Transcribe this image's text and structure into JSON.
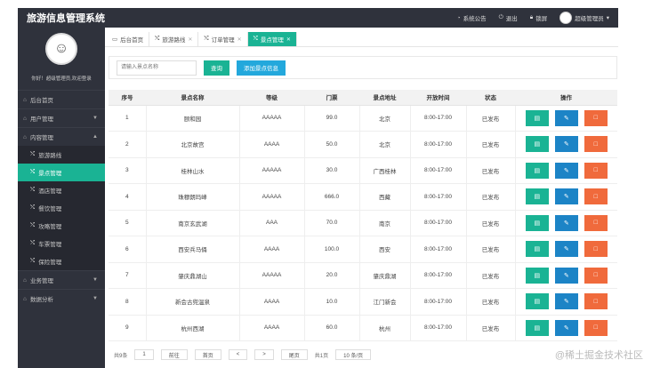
{
  "app": {
    "title": "旅游信息管理系统"
  },
  "topbar": {
    "notice": "系统公告",
    "logout": "退出",
    "lock": "锁屏",
    "user": "超级管理员"
  },
  "profile": {
    "greeting": "你好！超级管理员,欢迎登录"
  },
  "sidebar": {
    "home": "后台首页",
    "user_mgmt": "用户管理",
    "content_mgmt": "内容管理",
    "sub_items": [
      "旅游路线",
      "景点管理",
      "酒店管理",
      "餐饮管理",
      "攻略管理",
      "车票管理",
      "保险管理"
    ],
    "business": "业务管理",
    "analysis": "数据分析"
  },
  "tabs": [
    "后台首页",
    "旅游路线",
    "订单管理",
    "景点管理"
  ],
  "search": {
    "placeholder": "请输入景点名称",
    "query_btn": "查询",
    "add_btn": "添加景点信息"
  },
  "table": {
    "headers": [
      "序号",
      "景点名称",
      "等级",
      "门票",
      "景点地址",
      "开放时间",
      "状态",
      "操作"
    ],
    "rows": [
      [
        "1",
        "颐和园",
        "AAAAA",
        "99.0",
        "北京",
        "8:00-17:00",
        "已发布"
      ],
      [
        "2",
        "北京故宫",
        "AAAA",
        "50.0",
        "北京",
        "8:00-17:00",
        "已发布"
      ],
      [
        "3",
        "桂林山水",
        "AAAAA",
        "30.0",
        "广西桂林",
        "8:00-17:00",
        "已发布"
      ],
      [
        "4",
        "珠穆朗玛峰",
        "AAAAA",
        "666.0",
        "西藏",
        "8:00-17:00",
        "已发布"
      ],
      [
        "5",
        "南京玄武湖",
        "AAA",
        "70.0",
        "南京",
        "8:00-17:00",
        "已发布"
      ],
      [
        "6",
        "西安兵马俑",
        "AAAA",
        "100.0",
        "西安",
        "8:00-17:00",
        "已发布"
      ],
      [
        "7",
        "肇庆鼎湖山",
        "AAAAA",
        "20.0",
        "肇庆鼎湖",
        "8:00-17:00",
        "已发布"
      ],
      [
        "8",
        "新会古兜温泉",
        "AAAA",
        "10.0",
        "江门新会",
        "8:00-17:00",
        "已发布"
      ],
      [
        "9",
        "杭州西湖",
        "AAAA",
        "60.0",
        "杭州",
        "8:00-17:00",
        "已发布"
      ]
    ]
  },
  "pager": {
    "total": "共9条",
    "page": "1",
    "goto": "前往",
    "first": "首页",
    "prev": "<",
    "next": ">",
    "last": "尾页",
    "pages": "共1页",
    "per_page": "10 条/页"
  },
  "watermark": "@稀土掘金技术社区",
  "colors": {
    "sidebar_bg": "#2f323c",
    "accent": "#1ab394",
    "edit": "#1c84c6",
    "delete": "#f06a3c"
  }
}
